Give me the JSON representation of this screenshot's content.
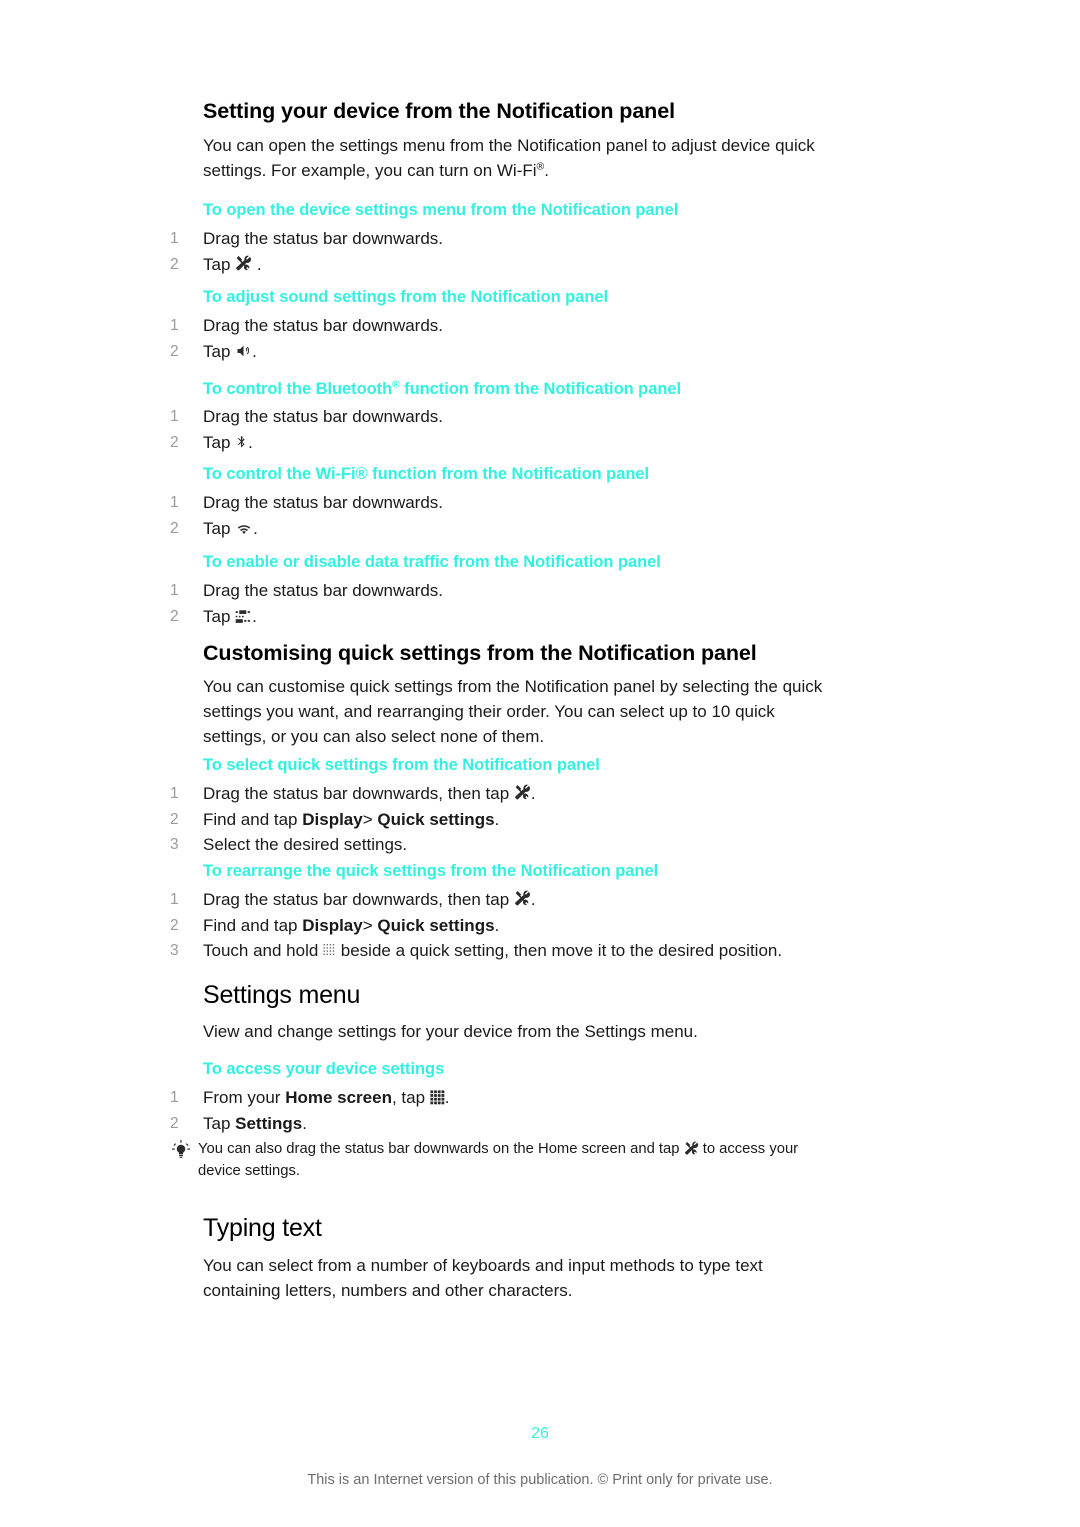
{
  "page": {
    "number": "26",
    "footer_note": "This is an Internet version of this publication. © Print only for private use."
  },
  "sections": [
    {
      "id": "setting-device",
      "heading": "Setting your device from the Notification panel",
      "intro_line1": "You can open the settings menu from the Notification panel to adjust device quick",
      "intro_line2_a": "settings. For example, you can turn on Wi-Fi",
      "intro_line2_sup": "®",
      "intro_line2_b": ".",
      "procedures": [
        {
          "title": "To open the device settings menu from the Notification panel",
          "steps": [
            {
              "num": "1",
              "text": "Drag the status bar downwards."
            },
            {
              "num": "2",
              "text_before": "Tap ",
              "icon": "settings-wrench-icon",
              "text_after": " ."
            }
          ]
        },
        {
          "title": "To adjust sound settings from the Notification panel",
          "steps": [
            {
              "num": "1",
              "text": "Drag the status bar downwards."
            },
            {
              "num": "2",
              "text_before": "Tap ",
              "icon": "speaker-volume-icon",
              "text_after": "."
            }
          ]
        },
        {
          "title_before": "To control the Bluetooth",
          "title_sup": "®",
          "title_after": " function from the Notification panel",
          "steps": [
            {
              "num": "1",
              "text": "Drag the status bar downwards."
            },
            {
              "num": "2",
              "text_before": "Tap ",
              "icon": "bluetooth-icon",
              "text_after": "."
            }
          ]
        },
        {
          "title": "To control the Wi-Fi® function from the Notification panel",
          "steps": [
            {
              "num": "1",
              "text": "Drag the status bar downwards."
            },
            {
              "num": "2",
              "text_before": "Tap ",
              "icon": "wifi-icon",
              "text_after": "."
            }
          ]
        },
        {
          "title": "To enable or disable data traffic from the Notification panel",
          "steps": [
            {
              "num": "1",
              "text": "Drag the status bar downwards."
            },
            {
              "num": "2",
              "text_before": "Tap ",
              "icon": "data-traffic-icon",
              "text_after": "."
            }
          ]
        }
      ]
    },
    {
      "id": "customising-quick-settings",
      "heading": "Customising quick settings from the Notification panel",
      "intro_line1": "You can customise quick settings from the Notification panel by selecting the quick",
      "intro_line2": "settings you want, and rearranging their order. You can select up to 10 quick",
      "intro_line3": "settings, or you can also select none of them.",
      "procedures": [
        {
          "title": "To select quick settings from the Notification panel",
          "steps": [
            {
              "num": "1",
              "text_before": "Drag the status bar downwards, then tap ",
              "icon": "settings-wrench-icon",
              "text_after": "."
            },
            {
              "num": "2",
              "text_before": "Find and tap ",
              "bold1": "Display",
              "mid": "> ",
              "bold2": "Quick settings",
              "text_after": "."
            },
            {
              "num": "3",
              "text": "Select the desired settings."
            }
          ]
        },
        {
          "title": "To rearrange the quick settings from the Notification panel",
          "steps": [
            {
              "num": "1",
              "text_before": "Drag the status bar downwards, then tap ",
              "icon": "settings-wrench-icon",
              "text_after": "."
            },
            {
              "num": "2",
              "text_before": "Find and tap ",
              "bold1": "Display",
              "mid": "> ",
              "bold2": "Quick settings",
              "text_after": "."
            },
            {
              "num": "3",
              "text_before": "Touch and hold ",
              "icon": "drag-handle-icon",
              "text_after": " beside a quick setting, then move it to the desired position."
            }
          ]
        }
      ]
    },
    {
      "id": "settings-menu",
      "heading": "Settings menu",
      "intro": "View and change settings for your device from the Settings menu.",
      "procedures": [
        {
          "title": "To access your device settings",
          "steps": [
            {
              "num": "1",
              "text_before": "From your ",
              "bold1": "Home screen",
              "mid": ", tap ",
              "icon": "app-grid-icon",
              "text_after": "."
            },
            {
              "num": "2",
              "text_before": "Tap ",
              "bold1": "Settings",
              "text_after": "."
            }
          ]
        }
      ],
      "tip": {
        "icon": "lightbulb-tip-icon",
        "line1_before": "You can also drag the status bar downwards on the Home screen and tap ",
        "line1_icon": "settings-wrench-icon",
        "line1_after": " to access your",
        "line2": "device settings."
      }
    },
    {
      "id": "typing-text",
      "heading": "Typing text",
      "intro_line1": "You can select from a number of keyboards and input methods to type text",
      "intro_line2": "containing letters, numbers and other characters."
    }
  ],
  "colors": {
    "accent": "#33f0e0",
    "body_text": "#1a1a1a",
    "list_number": "#9a9a9a",
    "footer_text": "#6d6d6d"
  }
}
